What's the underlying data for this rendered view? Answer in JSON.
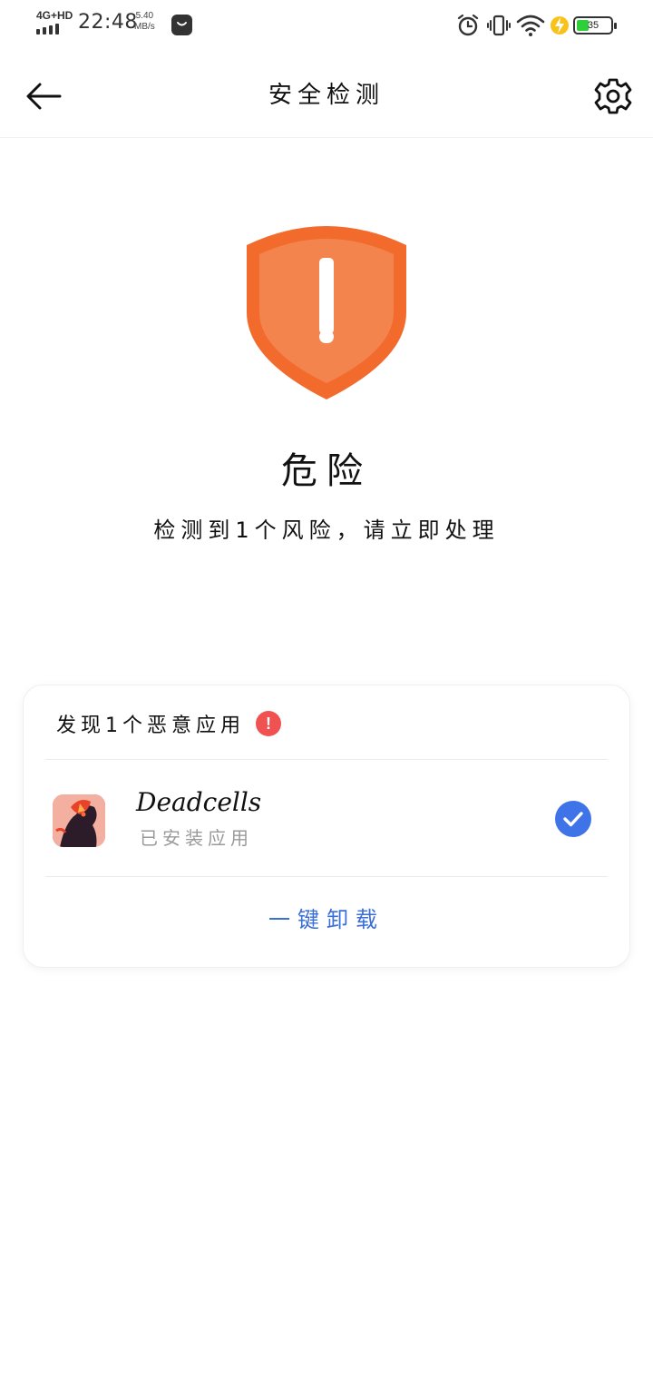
{
  "status_bar": {
    "network": "4G+HD",
    "time": "22:48",
    "speed_value": "5.40",
    "speed_unit": "MB/s",
    "battery": "35",
    "battery_level_percent": 35,
    "icons": [
      "signal-icon",
      "shop-icon",
      "alarm-icon",
      "vibrate-icon",
      "wifi-icon",
      "charging-icon",
      "battery-icon"
    ],
    "battery_color": "#2fcf3c"
  },
  "header": {
    "title": "安全检测",
    "back_icon": "back-arrow-icon",
    "settings_icon": "gear-icon"
  },
  "hero": {
    "shield_icon": "warning-shield-icon",
    "shield_color": "#f26b2d",
    "status": "危险",
    "description": "检测到1个风险，请立即处理"
  },
  "card": {
    "header": "发现1个恶意应用",
    "badge": "!",
    "badge_color": "#f05151",
    "apps": [
      {
        "name": "Deadcells",
        "subtitle": "已安装应用",
        "selected": true
      }
    ],
    "action": "一键卸载",
    "accent_color": "#3f73e8"
  }
}
